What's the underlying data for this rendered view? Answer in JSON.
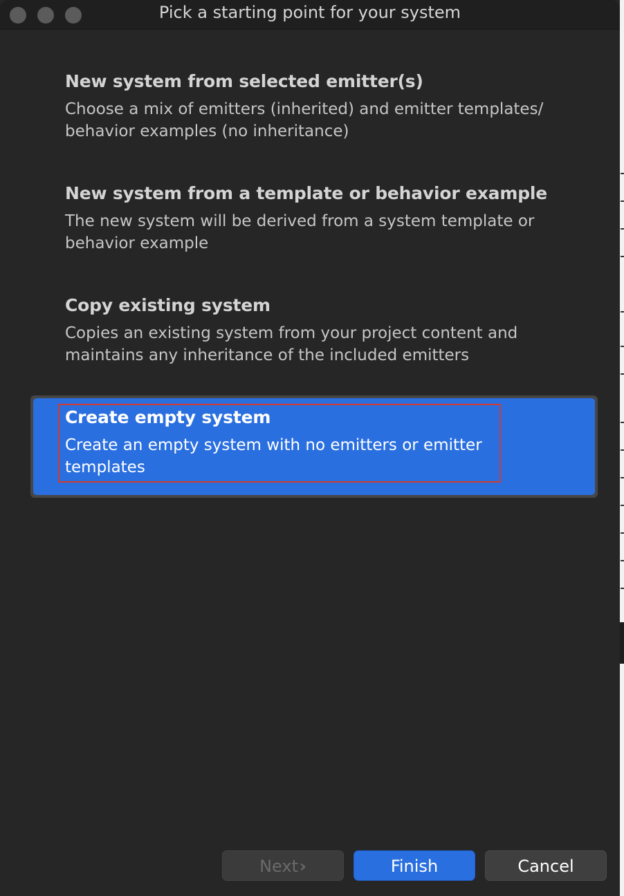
{
  "window": {
    "title": "Pick a starting point for your system"
  },
  "options": [
    {
      "title": "New system from selected emitter(s)",
      "description_line1": "Choose a mix of emitters (inherited) and emitter templates/",
      "description_line2": "behavior examples (no inheritance)"
    },
    {
      "title": "New system from a template or behavior example",
      "description_line1": "The new system will be derived from a system template or",
      "description_line2": "behavior example"
    },
    {
      "title": "Copy existing system",
      "description_line1": "Copies an existing system from your project content and",
      "description_line2": "maintains any inheritance of the included emitters"
    },
    {
      "title": "Create empty system",
      "description_line1": "Create an empty system with no emitters or emitter",
      "description_line2": "templates"
    }
  ],
  "selected_option": "Create empty system",
  "buttons": {
    "next_label": "Next",
    "next_icon": "chevron-right-icon",
    "finish_label": "Finish",
    "cancel_label": "Cancel"
  },
  "colors": {
    "accent": "#2a6fe0",
    "highlight_border": "#d03a2e",
    "background": "#262626"
  }
}
